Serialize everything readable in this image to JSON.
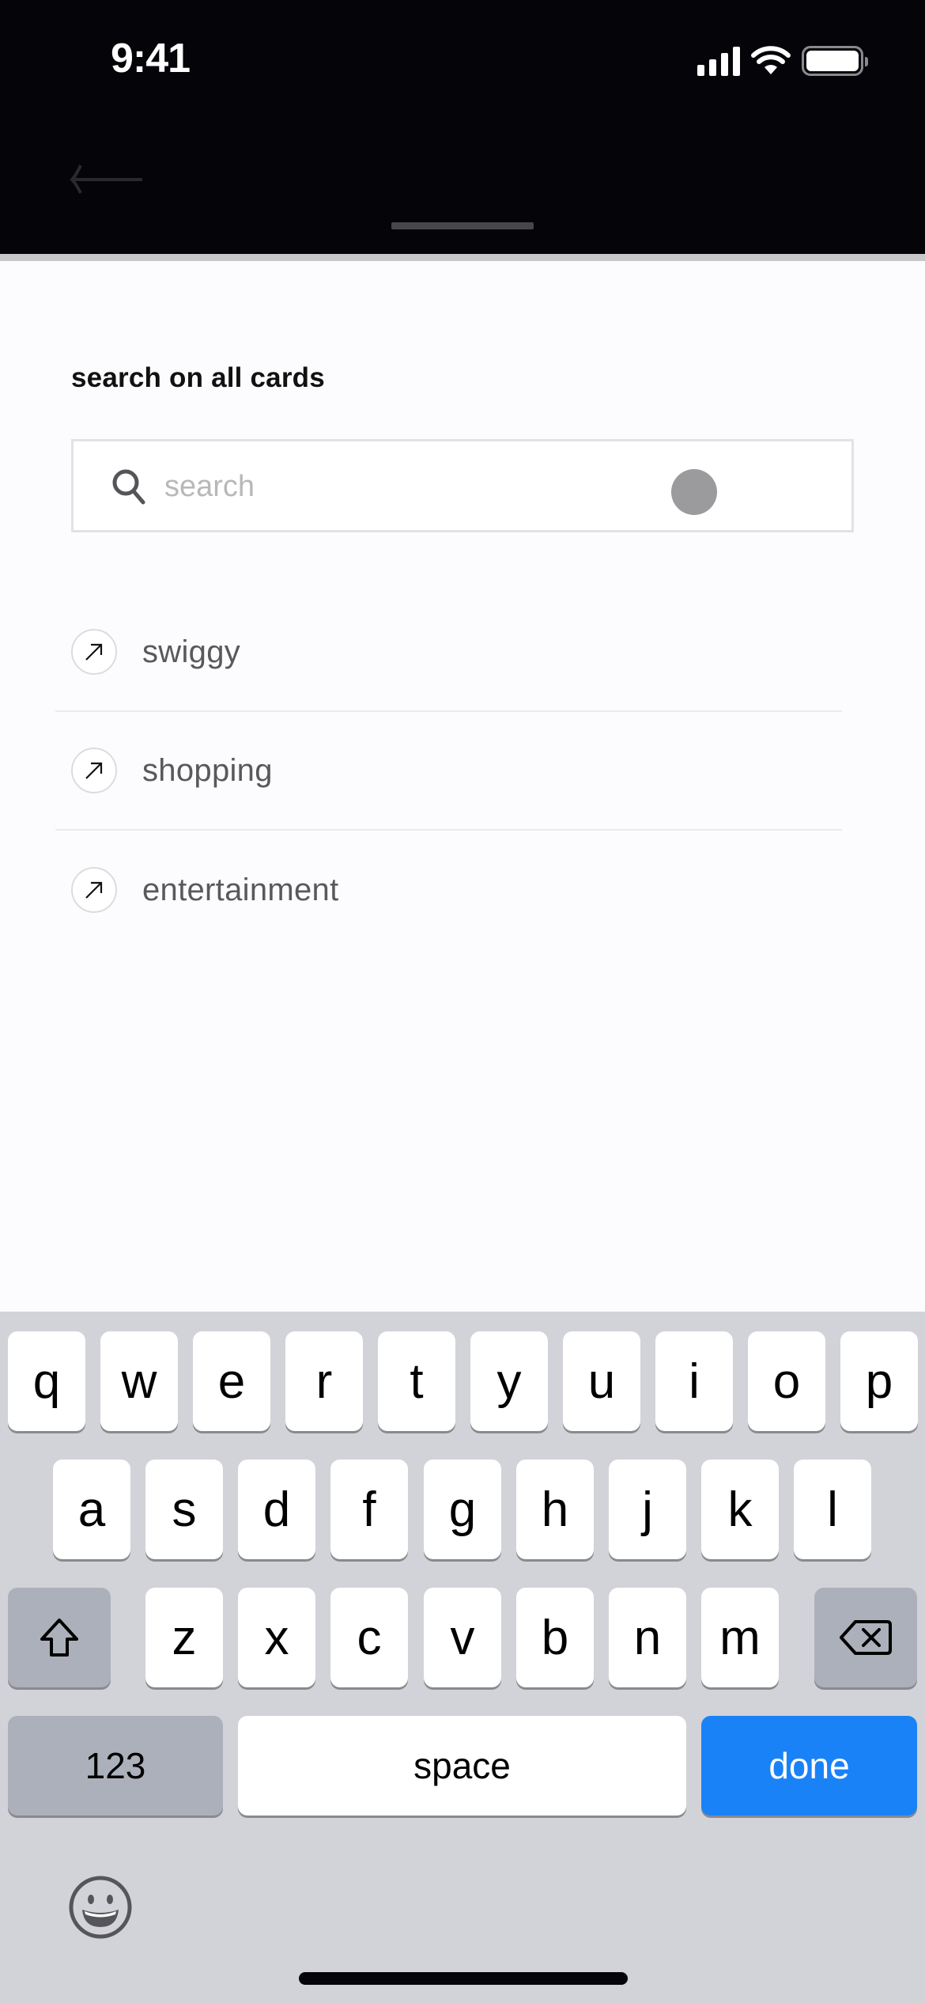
{
  "status_bar": {
    "time": "9:41",
    "icons": [
      "cellular-signal-icon",
      "wifi-icon",
      "battery-icon"
    ]
  },
  "nav": {
    "back_icon": "arrow-left-icon"
  },
  "sheet": {
    "title": "search on all cards",
    "search": {
      "placeholder": "search",
      "value": "",
      "icon": "search-icon"
    },
    "suggestions": [
      {
        "label": "swiggy",
        "icon": "arrow-up-right-icon"
      },
      {
        "label": "shopping",
        "icon": "arrow-up-right-icon"
      },
      {
        "label": "entertainment",
        "icon": "arrow-up-right-icon"
      }
    ]
  },
  "keyboard": {
    "row1": [
      "q",
      "w",
      "e",
      "r",
      "t",
      "y",
      "u",
      "i",
      "o",
      "p"
    ],
    "row2": [
      "a",
      "s",
      "d",
      "f",
      "g",
      "h",
      "j",
      "k",
      "l"
    ],
    "row3": [
      "z",
      "x",
      "c",
      "v",
      "b",
      "n",
      "m"
    ],
    "shift_icon": "shift-icon",
    "delete_icon": "backspace-icon",
    "numbers_label": "123",
    "space_label": "space",
    "done_label": "done",
    "emoji_icon": "emoji-icon",
    "accent_color": "#1a82f7"
  }
}
